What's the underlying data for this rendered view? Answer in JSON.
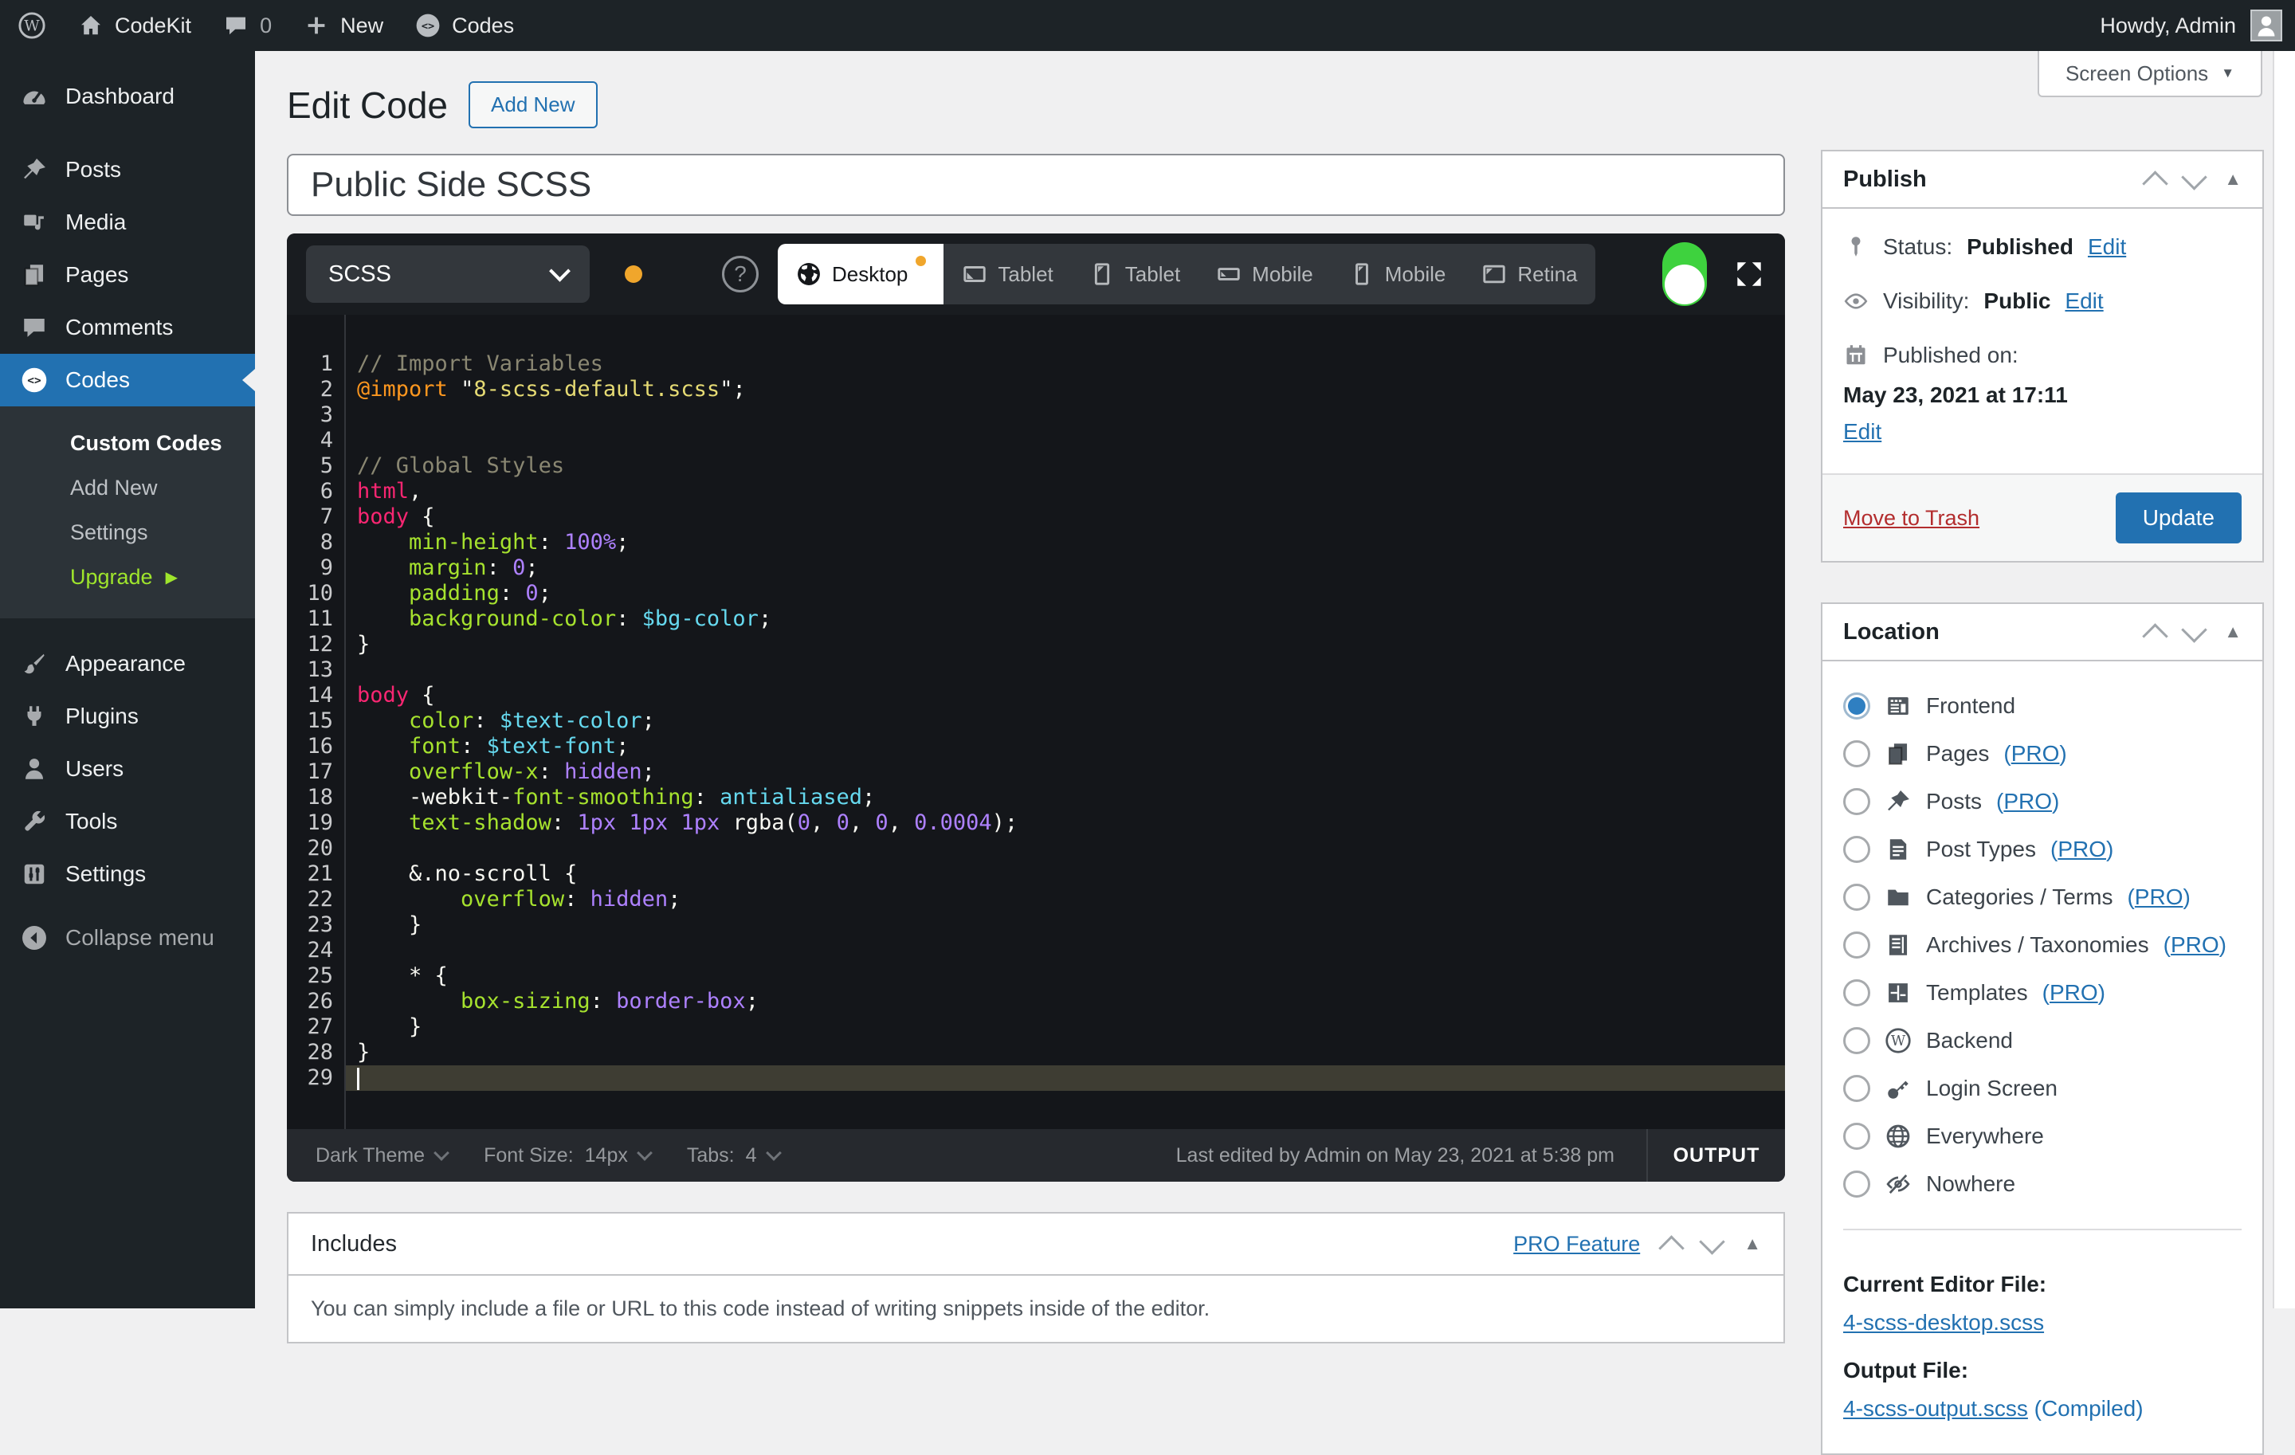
{
  "colors": {
    "accent_blue": "#2271b1",
    "menu_bg": "#1d2327",
    "toggle_green": "#3ed23e",
    "warning_dot": "#f0a62c",
    "upgrade_green": "#9fe52c",
    "trash_red": "#b32d2e",
    "editor_bg": "#14161a",
    "syntax": {
      "comment": "#8a8772",
      "keyword": "#fd971f",
      "string": "#e6db74",
      "selector": "#f92672",
      "property": "#a6e22e",
      "value": "#ae81ff",
      "variable": "#66d9ef",
      "plain": "#f8f8f2"
    }
  },
  "admin_bar": {
    "site": "CodeKit",
    "comments_count": "0",
    "new_label": "New",
    "codes_label": "Codes",
    "howdy": "Howdy, Admin"
  },
  "sidebar": {
    "top_items": [
      {
        "label": "Dashboard",
        "icon": "gauge"
      },
      {
        "label": "Posts",
        "icon": "pin"
      },
      {
        "label": "Media",
        "icon": "media"
      },
      {
        "label": "Pages",
        "icon": "pages"
      },
      {
        "label": "Comments",
        "icon": "bubble"
      },
      {
        "label": "Codes",
        "icon": "codecircle",
        "active": true
      }
    ],
    "submenu": [
      {
        "label": "Custom Codes",
        "active": true
      },
      {
        "label": "Add New"
      },
      {
        "label": "Settings"
      },
      {
        "label": "Upgrade",
        "upgrade": true
      }
    ],
    "bottom_items": [
      {
        "label": "Appearance",
        "icon": "brush"
      },
      {
        "label": "Plugins",
        "icon": "plug"
      },
      {
        "label": "Users",
        "icon": "user"
      },
      {
        "label": "Tools",
        "icon": "wrench"
      },
      {
        "label": "Settings",
        "icon": "sliders"
      },
      {
        "label": "Collapse menu",
        "icon": "collapsecirc",
        "collapse": true
      }
    ]
  },
  "page": {
    "title": "Edit Code",
    "add_new": "Add New"
  },
  "title_input": {
    "value": "Public Side SCSS"
  },
  "editor": {
    "language": "SCSS",
    "tabs": [
      {
        "label": "Desktop",
        "icon": "earth",
        "active": true,
        "dot": true
      },
      {
        "label": "Tablet",
        "icon": "tabland"
      },
      {
        "label": "Tablet",
        "icon": "tabport"
      },
      {
        "label": "Mobile",
        "icon": "mobland"
      },
      {
        "label": "Mobile",
        "icon": "mobport"
      },
      {
        "label": "Retina",
        "icon": "retina"
      }
    ],
    "footer": {
      "theme": "Dark Theme",
      "font_size_label": "Font Size:",
      "font_size": "14px",
      "tabs_label": "Tabs:",
      "tabs_count": "4",
      "last_edited": "Last edited by Admin on May 23, 2021 at 5:38 pm",
      "output": "OUTPUT"
    },
    "code": {
      "active_line": 29,
      "lines": [
        [
          [
            "c",
            "// Import Variables"
          ]
        ],
        [
          [
            "k",
            "@import"
          ],
          [
            "t",
            " "
          ],
          [
            "q",
            "\""
          ],
          [
            "s",
            "8-scss-default.scss"
          ],
          [
            "q",
            "\""
          ],
          [
            "t",
            ";"
          ]
        ],
        [],
        [],
        [
          [
            "c",
            "// Global Styles"
          ]
        ],
        [
          [
            "sel",
            "html"
          ],
          [
            "t",
            ","
          ]
        ],
        [
          [
            "sel",
            "body"
          ],
          [
            "t",
            " {"
          ]
        ],
        [
          [
            "t",
            "    "
          ],
          [
            "p",
            "min-height"
          ],
          [
            "t",
            ": "
          ],
          [
            "n",
            "100%"
          ],
          [
            "t",
            ";"
          ]
        ],
        [
          [
            "t",
            "    "
          ],
          [
            "p",
            "margin"
          ],
          [
            "t",
            ": "
          ],
          [
            "n",
            "0"
          ],
          [
            "t",
            ";"
          ]
        ],
        [
          [
            "t",
            "    "
          ],
          [
            "p",
            "padding"
          ],
          [
            "t",
            ": "
          ],
          [
            "n",
            "0"
          ],
          [
            "t",
            ";"
          ]
        ],
        [
          [
            "t",
            "    "
          ],
          [
            "p",
            "background-color"
          ],
          [
            "t",
            ": "
          ],
          [
            "v",
            "$bg-color"
          ],
          [
            "t",
            ";"
          ]
        ],
        [
          [
            "t",
            "}"
          ]
        ],
        [],
        [
          [
            "sel",
            "body"
          ],
          [
            "t",
            " {"
          ]
        ],
        [
          [
            "t",
            "    "
          ],
          [
            "p",
            "color"
          ],
          [
            "t",
            ": "
          ],
          [
            "v",
            "$text-color"
          ],
          [
            "t",
            ";"
          ]
        ],
        [
          [
            "t",
            "    "
          ],
          [
            "p",
            "font"
          ],
          [
            "t",
            ": "
          ],
          [
            "v",
            "$text-font"
          ],
          [
            "t",
            ";"
          ]
        ],
        [
          [
            "t",
            "    "
          ],
          [
            "p",
            "overflow-x"
          ],
          [
            "t",
            ": "
          ],
          [
            "n",
            "hidden"
          ],
          [
            "t",
            ";"
          ]
        ],
        [
          [
            "t",
            "    -webkit-"
          ],
          [
            "p",
            "font-smoothing"
          ],
          [
            "t",
            ": "
          ],
          [
            "v",
            "antialiased"
          ],
          [
            "t",
            ";"
          ]
        ],
        [
          [
            "t",
            "    "
          ],
          [
            "p",
            "text-shadow"
          ],
          [
            "t",
            ": "
          ],
          [
            "n",
            "1px"
          ],
          [
            "t",
            " "
          ],
          [
            "n",
            "1px"
          ],
          [
            "t",
            " "
          ],
          [
            "n",
            "1px"
          ],
          [
            "t",
            " rgba("
          ],
          [
            "n",
            "0"
          ],
          [
            "t",
            ", "
          ],
          [
            "n",
            "0"
          ],
          [
            "t",
            ", "
          ],
          [
            "n",
            "0"
          ],
          [
            "t",
            ", "
          ],
          [
            "n",
            "0.0004"
          ],
          [
            "t",
            ");"
          ]
        ],
        [],
        [
          [
            "t",
            "    &.no-scroll {"
          ]
        ],
        [
          [
            "t",
            "        "
          ],
          [
            "p",
            "overflow"
          ],
          [
            "t",
            ": "
          ],
          [
            "n",
            "hidden"
          ],
          [
            "t",
            ";"
          ]
        ],
        [
          [
            "t",
            "    }"
          ]
        ],
        [],
        [
          [
            "t",
            "    * {"
          ]
        ],
        [
          [
            "t",
            "        "
          ],
          [
            "p",
            "box-sizing"
          ],
          [
            "t",
            ": "
          ],
          [
            "n",
            "border-box"
          ],
          [
            "t",
            ";"
          ]
        ],
        [
          [
            "t",
            "    }"
          ]
        ],
        [
          [
            "t",
            "}"
          ]
        ],
        []
      ]
    }
  },
  "includes": {
    "title": "Includes",
    "pro": "PRO Feature",
    "description": "You can simply include a file or URL to this code instead of writing snippets inside of the editor."
  },
  "screen_options": {
    "label": "Screen Options"
  },
  "publish": {
    "title": "Publish",
    "status_label": "Status:",
    "status_value": "Published",
    "visibility_label": "Visibility:",
    "visibility_value": "Public",
    "published_label": "Published on:",
    "published_value": "May 23, 2021 at 17:11",
    "edit": "Edit",
    "move_to_trash": "Move to Trash",
    "update": "Update"
  },
  "location": {
    "title": "Location",
    "options": [
      {
        "label": "Frontend",
        "icon": "grid",
        "selected": true
      },
      {
        "label": "Pages",
        "icon": "pages",
        "pro": "PRO"
      },
      {
        "label": "Posts",
        "icon": "pin",
        "pro": "PRO"
      },
      {
        "label": "Post Types",
        "icon": "doc",
        "pro": "PRO"
      },
      {
        "label": "Categories / Terms",
        "icon": "folder",
        "pro": "PRO"
      },
      {
        "label": "Archives / Taxonomies",
        "icon": "archive",
        "pro": "PRO"
      },
      {
        "label": "Templates",
        "icon": "layout",
        "pro": "PRO"
      },
      {
        "label": "Backend",
        "icon": "wplogo"
      },
      {
        "label": "Login Screen",
        "icon": "key"
      },
      {
        "label": "Everywhere",
        "icon": "globe"
      },
      {
        "label": "Nowhere",
        "icon": "eyeslash"
      }
    ],
    "current_file_label": "Current Editor File:",
    "current_file": "4-scss-desktop.scss",
    "output_file_label": "Output File:",
    "output_file": "4-scss-output.scss",
    "output_file_note": "(Compiled)"
  }
}
